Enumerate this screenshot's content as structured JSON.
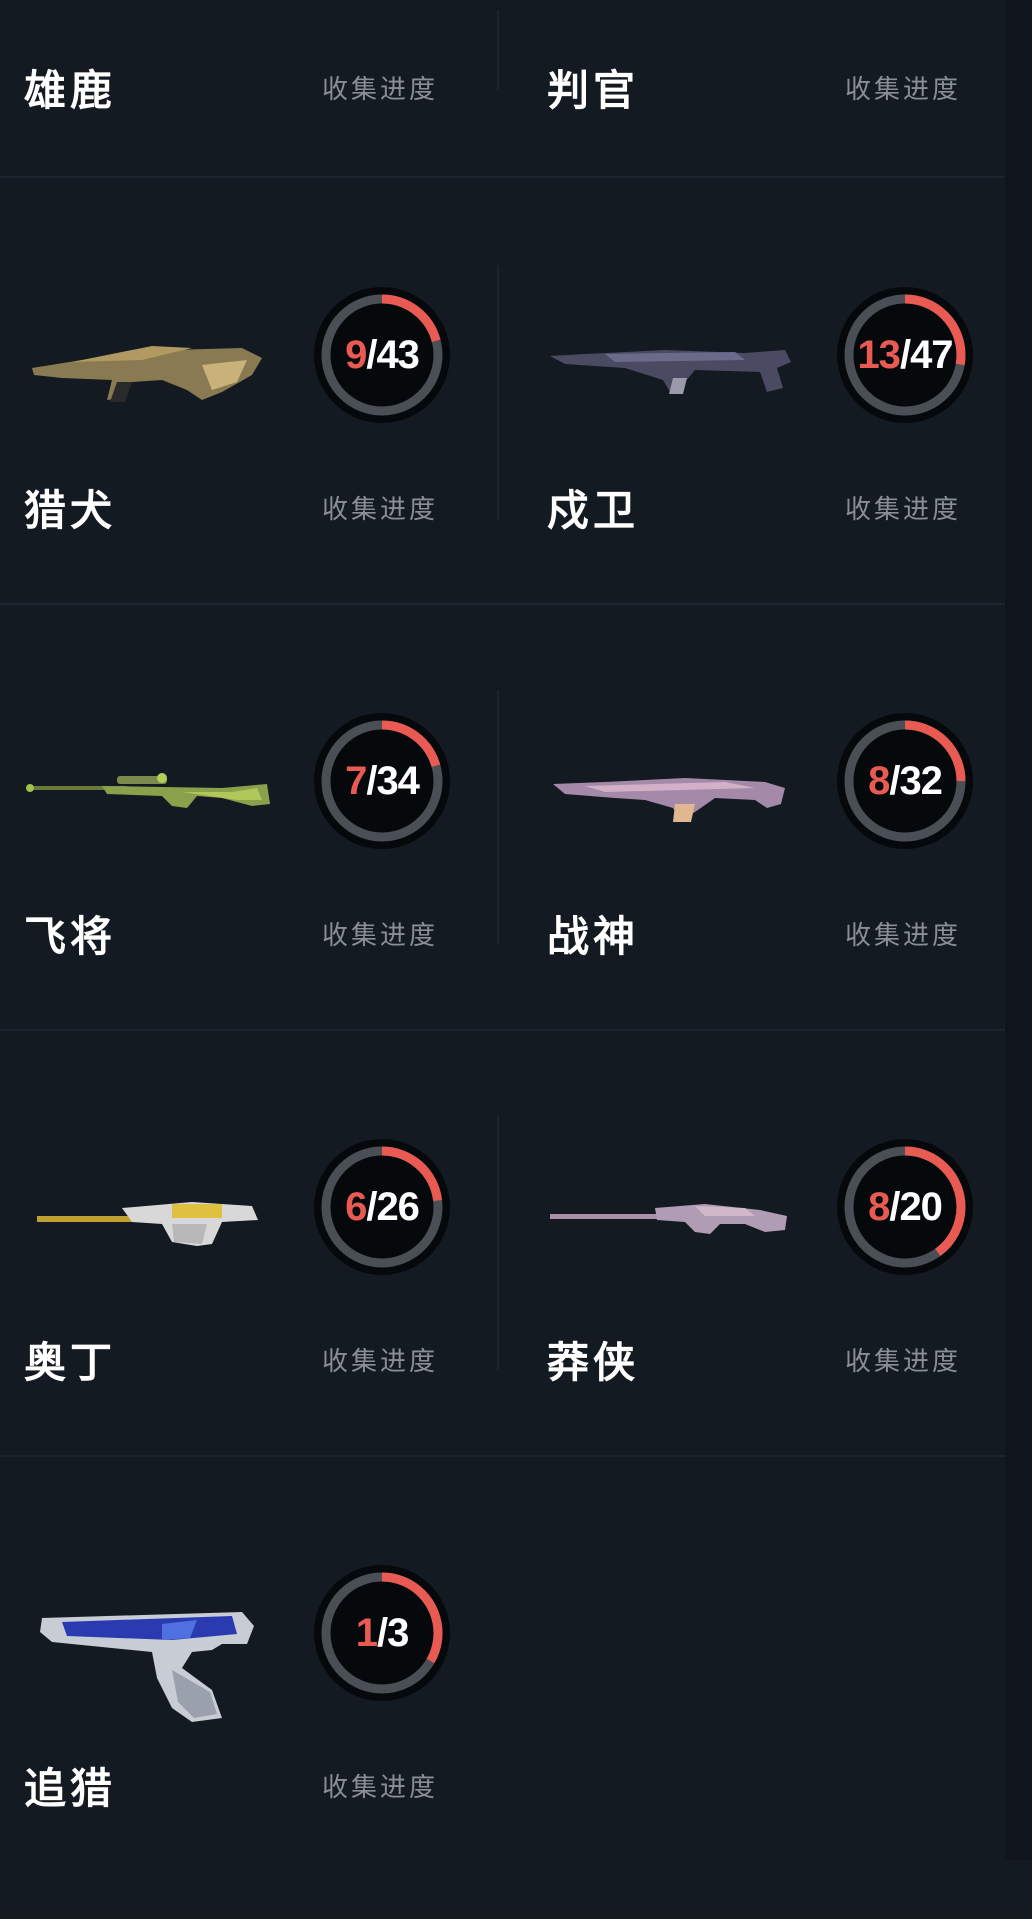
{
  "colors": {
    "background": "#131a21",
    "ring_track": "#4a4f56",
    "ring_progress": "#e85a52",
    "ring_center": "#06090c",
    "name_text": "#ffffff",
    "label_text": "#8a8f95"
  },
  "top_row": [
    {
      "name": "雄鹿",
      "progress_label": "收集进度"
    },
    {
      "name": "判官",
      "progress_label": "收集进度"
    }
  ],
  "weapons": [
    {
      "name": "猎犬",
      "owned": "9",
      "slash": "/",
      "total": "43",
      "fraction": 0.209,
      "progress_label": "收集进度",
      "icon": "rifle-gold-icon"
    },
    {
      "name": "戍卫",
      "owned": "13",
      "slash": "/",
      "total": "47",
      "fraction": 0.277,
      "progress_label": "收集进度",
      "icon": "rifle-dark-icon"
    },
    {
      "name": "飞将",
      "owned": "7",
      "slash": "/",
      "total": "34",
      "fraction": 0.206,
      "progress_label": "收集进度",
      "icon": "sniper-green-icon"
    },
    {
      "name": "战神",
      "owned": "8",
      "slash": "/",
      "total": "32",
      "fraction": 0.25,
      "progress_label": "收集进度",
      "icon": "machinegun-pink-icon"
    },
    {
      "name": "奥丁",
      "owned": "6",
      "slash": "/",
      "total": "26",
      "fraction": 0.231,
      "progress_label": "收集进度",
      "icon": "machinegun-gold-icon"
    },
    {
      "name": "莽侠",
      "owned": "8",
      "slash": "/",
      "total": "20",
      "fraction": 0.4,
      "progress_label": "收集进度",
      "icon": "sniper-pink-icon"
    },
    {
      "name": "追猎",
      "owned": "1",
      "slash": "/",
      "total": "3",
      "fraction": 0.333,
      "progress_label": "收集进度",
      "icon": "pistol-blue-icon"
    }
  ]
}
